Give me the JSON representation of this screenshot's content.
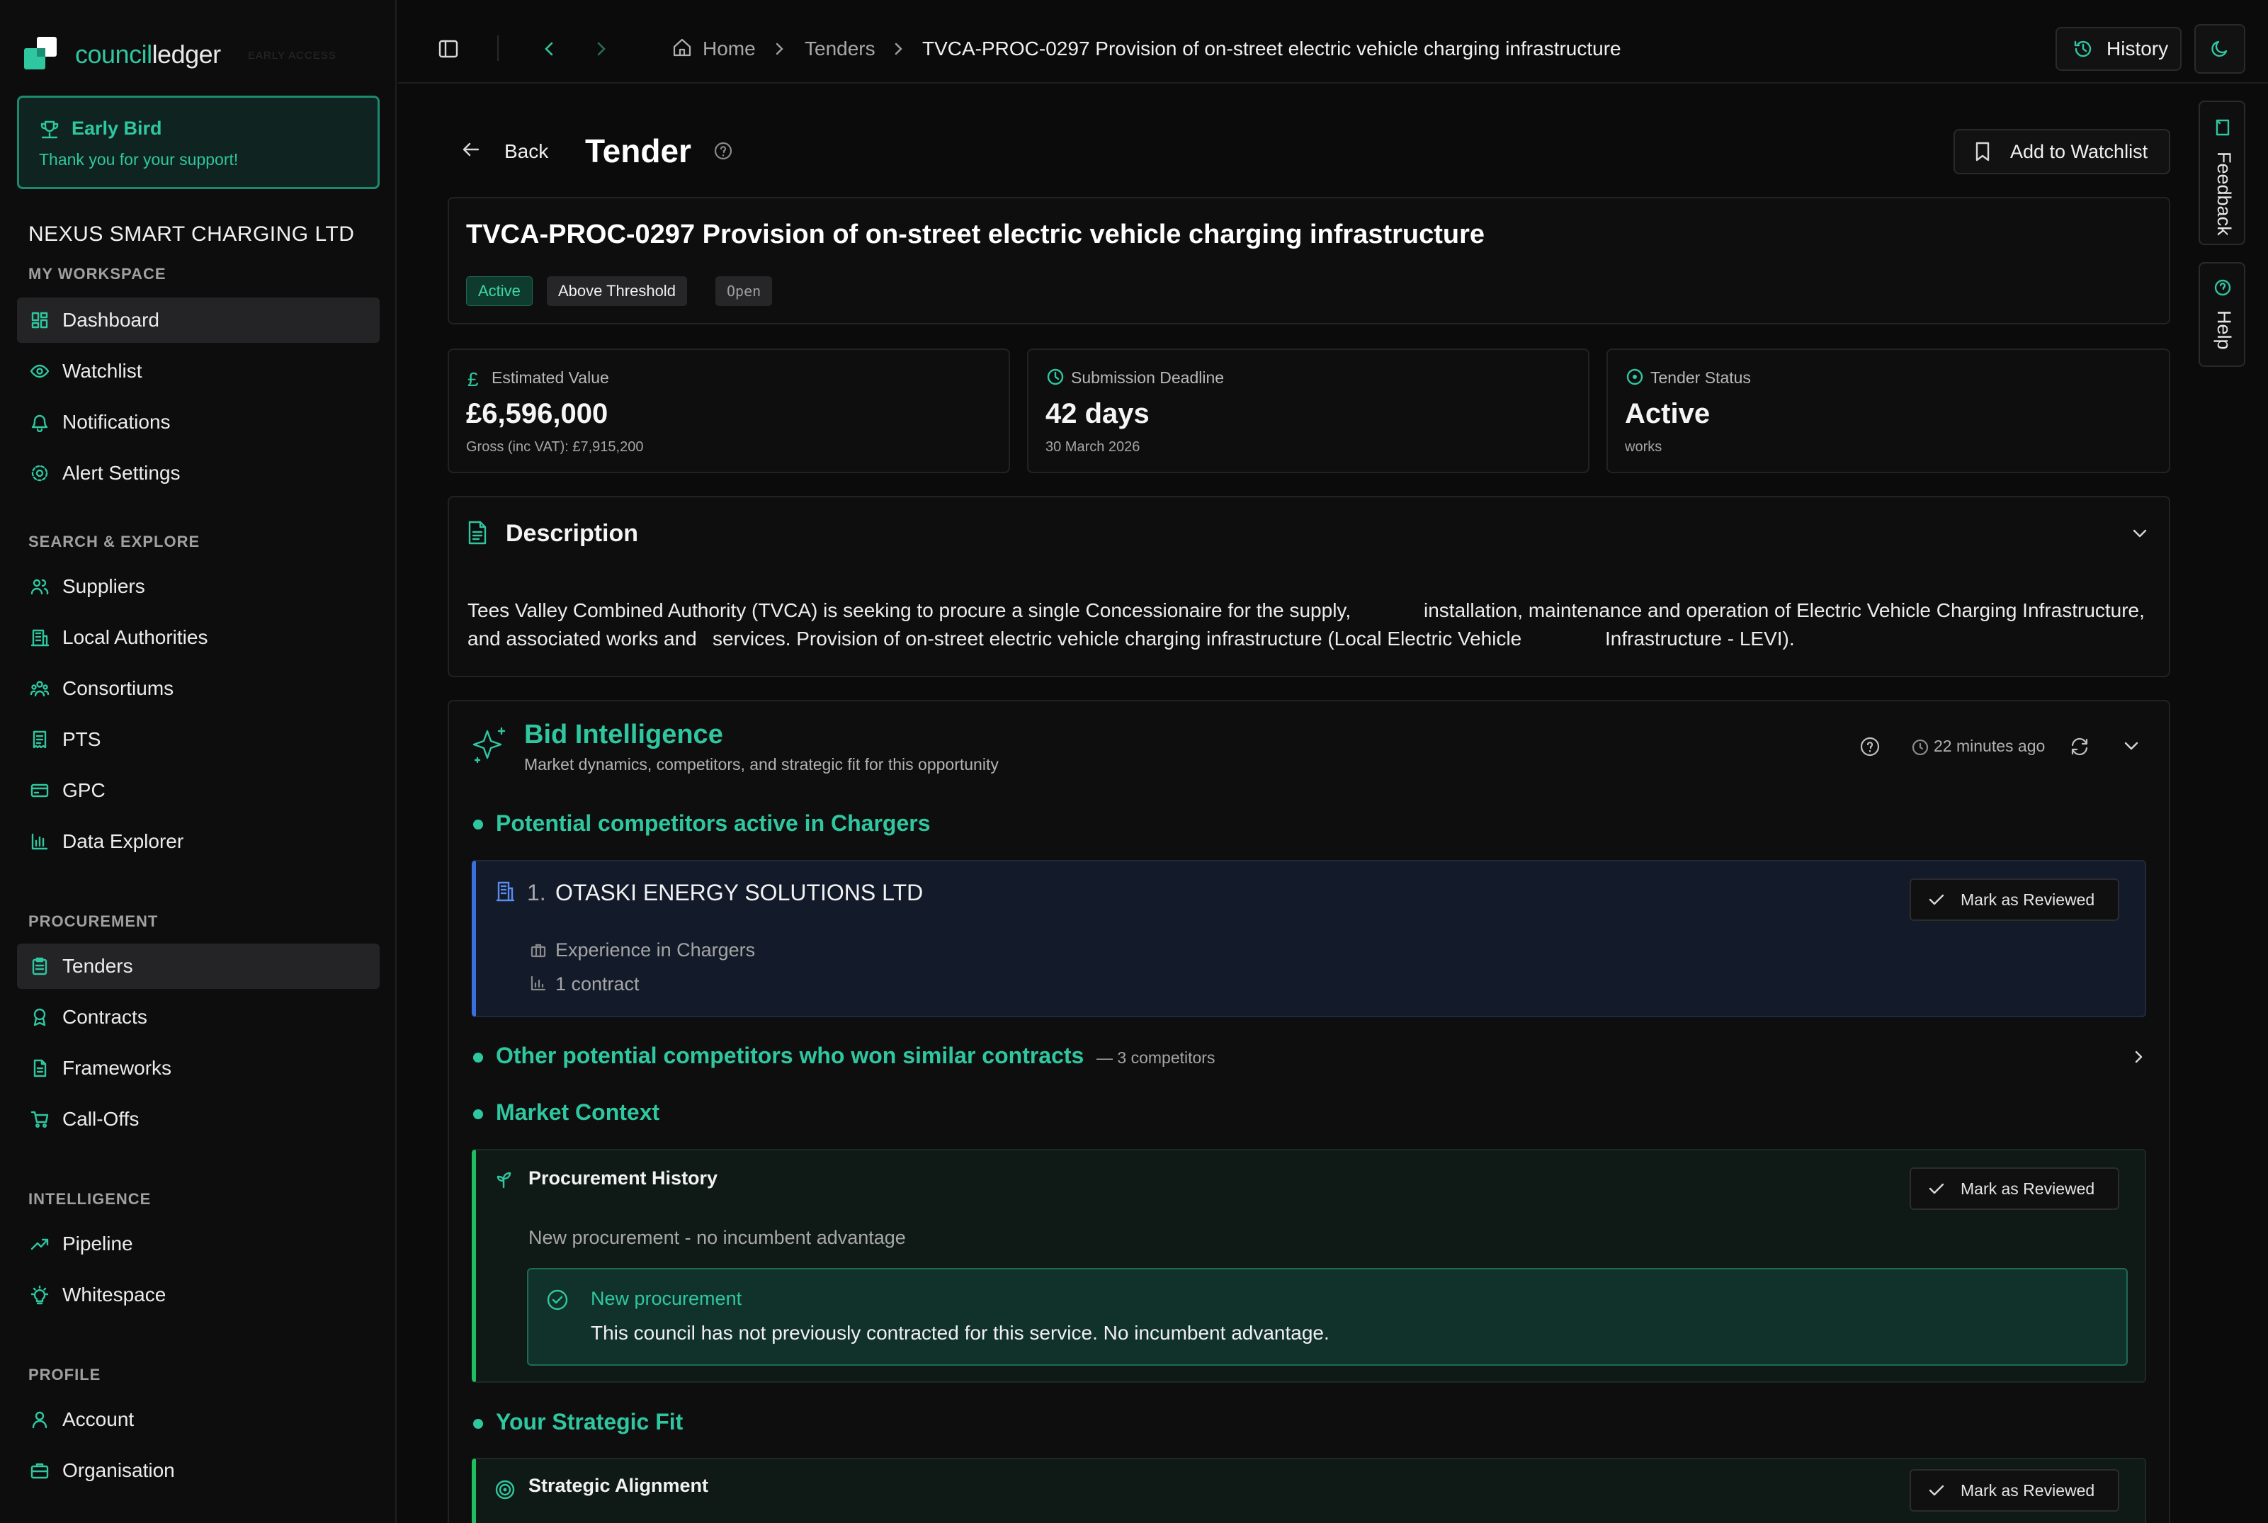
{
  "brand": {
    "name_part1": "council",
    "name_part2": "ledger",
    "tag": "EARLY ACCESS"
  },
  "early_bird": {
    "title": "Early Bird",
    "message": "Thank you for your support!"
  },
  "org_name": "NEXUS SMART CHARGING LTD",
  "sidebar": {
    "workspace_title": "MY WORKSPACE",
    "workspace": [
      "Dashboard",
      "Watchlist",
      "Notifications",
      "Alert Settings"
    ],
    "search_title": "SEARCH & EXPLORE",
    "search": [
      "Suppliers",
      "Local Authorities",
      "Consortiums",
      "PTS",
      "GPC",
      "Data Explorer"
    ],
    "procurement_title": "PROCUREMENT",
    "procurement": [
      "Tenders",
      "Contracts",
      "Frameworks",
      "Call-Offs"
    ],
    "intelligence_title": "INTELLIGENCE",
    "intelligence": [
      "Pipeline",
      "Whitespace"
    ],
    "profile_title": "PROFILE",
    "profile": [
      "Account",
      "Organisation"
    ]
  },
  "breadcrumb": {
    "home": "Home",
    "tenders": "Tenders",
    "current": "TVCA-PROC-0297 Provision of on-street electric vehicle charging infrastructure"
  },
  "header": {
    "history": "History"
  },
  "side_tabs": {
    "feedback": "Feedback",
    "help": "Help"
  },
  "page": {
    "back": "Back",
    "title": "Tender",
    "watchlist": "Add to Watchlist"
  },
  "tender": {
    "title": "TVCA-PROC-0297 Provision of on-street electric vehicle charging infrastructure",
    "badges": {
      "status": "Active",
      "threshold": "Above Threshold",
      "procedure": "Open"
    }
  },
  "stats": {
    "value_label": "Estimated Value",
    "value": "£6,596,000",
    "value_sub": "Gross (inc VAT): £7,915,200",
    "deadline_label": "Submission Deadline",
    "deadline": "42 days",
    "deadline_sub": "30 March 2026",
    "status_label": "Tender Status",
    "status": "Active",
    "status_sub": "works"
  },
  "description": {
    "title": "Description",
    "line1a": "Tees Valley Combined Authority (TVCA) is seeking to procure a single Concessionaire for the supply,",
    "line1b": "installation, maintenance and operation of Electric Vehicle Charging Infrastructure,",
    "line2a": "and associated works and",
    "line2b": "services. Provision of on-street electric vehicle charging infrastructure (Local Electric Vehicle",
    "line2c": "Infrastructure - LEVI)."
  },
  "bid": {
    "title": "Bid Intelligence",
    "subtitle": "Market dynamics, competitors, and strategic fit for this opportunity",
    "updated": "22 minutes ago",
    "competitors_head": "Potential competitors active in Chargers",
    "competitor": {
      "rank": "1.",
      "name": "OTASKI ENERGY SOLUTIONS LTD",
      "experience": "Experience in Chargers",
      "contracts": "1 contract"
    },
    "mark_reviewed": "Mark as Reviewed",
    "other_head": "Other potential competitors who won similar contracts",
    "other_count": "— 3 competitors",
    "market_head": "Market Context",
    "history_title": "Procurement History",
    "history_text": "New procurement - no incumbent advantage",
    "new_title": "New procurement",
    "new_text": "This council has not previously contracted for this service. No incumbent advantage.",
    "fit_head": "Your Strategic Fit",
    "alignment_title": "Strategic Alignment"
  },
  "colors": {
    "accent": "#2fc7a0",
    "blue": "#3b6fe0",
    "green": "#1fbf5f"
  }
}
